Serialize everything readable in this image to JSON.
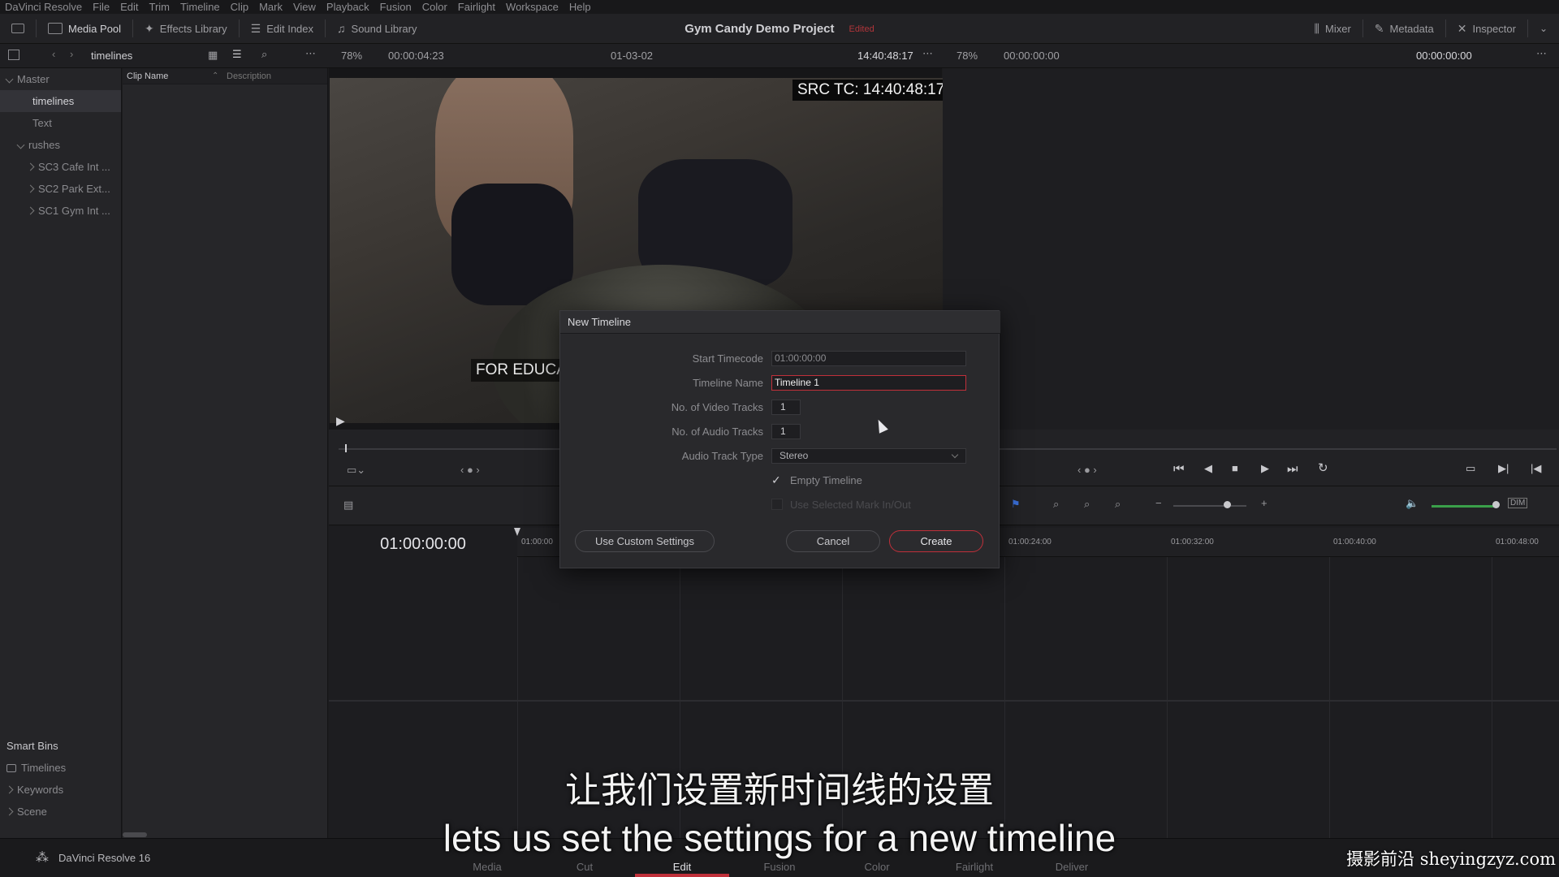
{
  "menu": [
    "DaVinci Resolve",
    "File",
    "Edit",
    "Trim",
    "Timeline",
    "Clip",
    "Mark",
    "View",
    "Playback",
    "Fusion",
    "Color",
    "Fairlight",
    "Workspace",
    "Help"
  ],
  "toolbar": {
    "media_pool": "Media Pool",
    "effects_library": "Effects Library",
    "edit_index": "Edit Index",
    "sound_library": "Sound Library",
    "project_title": "Gym Candy Demo Project",
    "edited": "Edited",
    "mixer": "Mixer",
    "metadata": "Metadata",
    "inspector": "Inspector"
  },
  "subbar": {
    "bin_name": "timelines",
    "src_zoom": "78%",
    "src_duration": "00:00:04:23",
    "clip_name": "01-03-02",
    "src_timecode": "14:40:48:17",
    "rec_zoom": "78%",
    "rec_duration": "00:00:00:00",
    "rec_timecode": "00:00:00:00"
  },
  "bins": {
    "master": "Master",
    "items": [
      "timelines",
      "Text"
    ],
    "rushes": "rushes",
    "rush_items": [
      "SC3 Cafe Int ...",
      "SC2 Park Ext...",
      "SC1 Gym Int ..."
    ],
    "smart_bins": "Smart Bins",
    "smart_items": [
      "Timelines",
      "Keywords",
      "Scene"
    ]
  },
  "clips": {
    "col_name": "Clip Name",
    "col_desc": "Description"
  },
  "viewer": {
    "src_tc": "SRC TC: 14:40:48:17",
    "burnin": "FOR EDUCA"
  },
  "timeline": {
    "timecode": "01:00:00:00",
    "ruler": [
      "01:00:00",
      "01:00:24:00",
      "01:00:32:00",
      "01:00:40:00",
      "01:00:48:00"
    ]
  },
  "dialog": {
    "title": "New Timeline",
    "start_tc_label": "Start Timecode",
    "start_tc_value": "01:00:00:00",
    "name_label": "Timeline Name",
    "name_value": "Timeline 1",
    "video_label": "No. of Video Tracks",
    "video_value": "1",
    "audio_label": "No. of Audio Tracks",
    "audio_value": "1",
    "type_label": "Audio Track Type",
    "type_value": "Stereo",
    "empty_label": "Empty Timeline",
    "empty_checked": true,
    "mark_label": "Use Selected Mark In/Out",
    "custom_btn": "Use Custom Settings",
    "cancel_btn": "Cancel",
    "create_btn": "Create"
  },
  "bottom": {
    "app": "DaVinci Resolve 16",
    "pages": [
      "Media",
      "Cut",
      "Edit",
      "Fusion",
      "Color",
      "Fairlight",
      "Deliver"
    ],
    "active_page": "Edit"
  },
  "subtitles": {
    "cn": "让我们设置新时间线的设置",
    "en": "lets us set the settings for a new timeline"
  },
  "watermark": "摄影前沿 sheyingzyz.com",
  "colors": {
    "accent": "#c0303a",
    "bg": "#1c1c1e"
  }
}
